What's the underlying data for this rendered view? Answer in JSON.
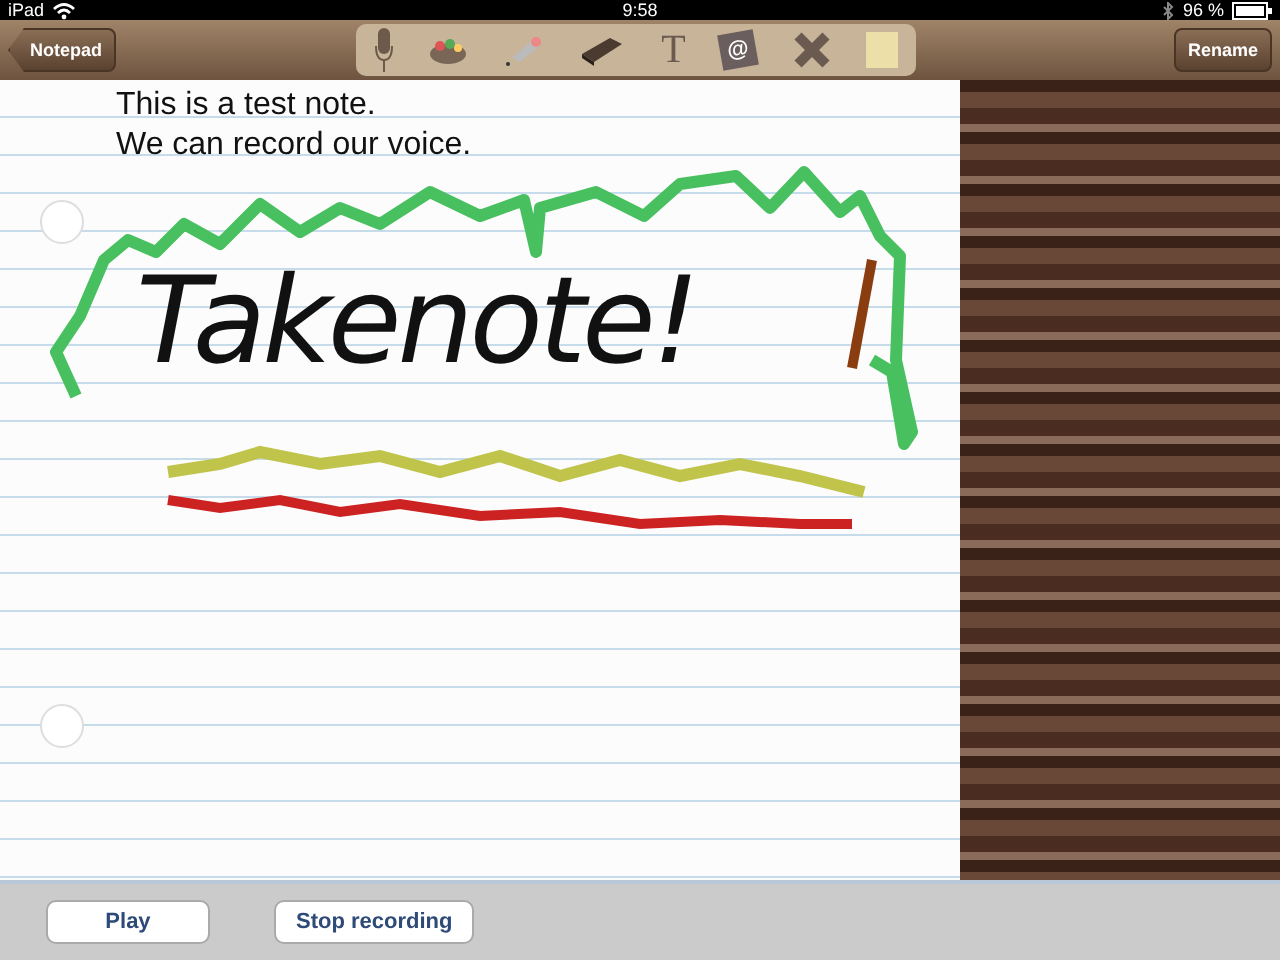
{
  "status_bar": {
    "device": "iPad",
    "time": "9:58",
    "battery": "96 %"
  },
  "toolbar": {
    "back_button": "Notepad",
    "rename_button": "Rename",
    "tools": [
      {
        "kind": "microphone"
      },
      {
        "kind": "palette"
      },
      {
        "kind": "pen"
      },
      {
        "kind": "eraser"
      },
      {
        "kind": "text",
        "glyph": "T"
      },
      {
        "kind": "email",
        "glyph": "@"
      },
      {
        "kind": "delete"
      },
      {
        "kind": "sticky"
      }
    ]
  },
  "note": {
    "lines": [
      "This is a test note.",
      "We can record our voice."
    ],
    "ink_text": "Takenote!"
  },
  "bottom_bar": {
    "buttons": [
      "Play",
      "Stop recording"
    ]
  }
}
